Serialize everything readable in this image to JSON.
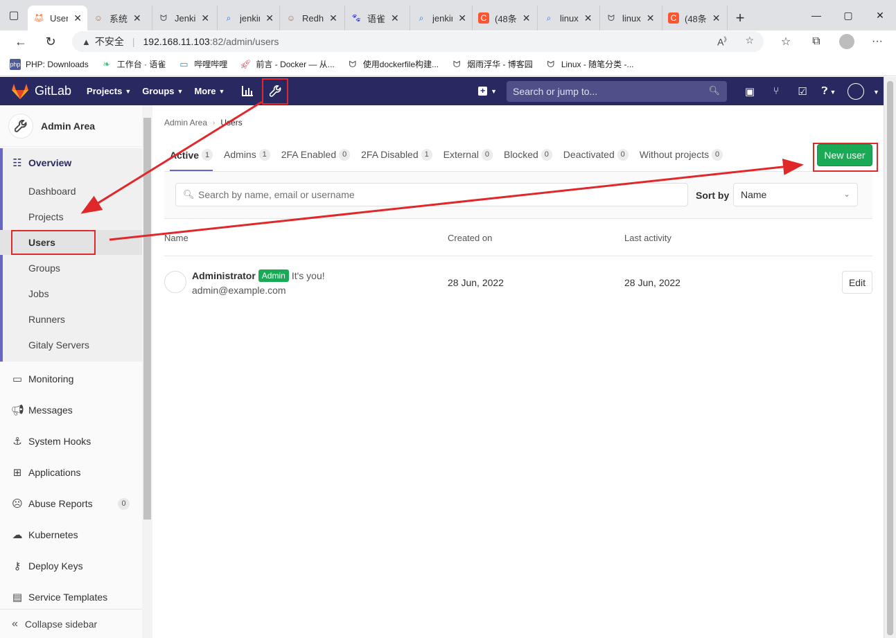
{
  "browser": {
    "tabs": [
      {
        "label": "Users",
        "icon": "gitlab-icon",
        "color": "#fc6d26",
        "active": true
      },
      {
        "label": "系统",
        "icon": "person-icon",
        "color": "#b07050"
      },
      {
        "label": "Jenki",
        "icon": "yuque-icon",
        "color": "#555"
      },
      {
        "label": "jenkir",
        "icon": "search-icon",
        "color": "#1a73e8"
      },
      {
        "label": "Redh",
        "icon": "person-icon",
        "color": "#b07050"
      },
      {
        "label": "语雀",
        "icon": "baidu-icon",
        "color": "#2932e1"
      },
      {
        "label": "jenkir",
        "icon": "search-icon",
        "color": "#1a73e8"
      },
      {
        "label": "(48条",
        "icon": "csdn-icon",
        "color": "#fc5531"
      },
      {
        "label": "linux",
        "icon": "search-icon",
        "color": "#1a73e8"
      },
      {
        "label": "linux",
        "icon": "yuque-icon",
        "color": "#555"
      },
      {
        "label": "(48条",
        "icon": "csdn-icon",
        "color": "#fc5531"
      }
    ],
    "address": {
      "insecure_label": "不安全",
      "host": "192.168.11.103",
      "path": ":82/admin/users"
    },
    "bookmarks": [
      {
        "label": "PHP: Downloads",
        "icon": "php-icon",
        "color": "#4f5b93"
      },
      {
        "label": "工作台 · 语雀",
        "icon": "yuque-leaf-icon",
        "color": "#31cc79"
      },
      {
        "label": "哔哩哔哩",
        "icon": "bilibili-icon",
        "color": "#00a1d6"
      },
      {
        "label": "前言 - Docker — 从...",
        "icon": "rocket-icon",
        "color": "#e84a5f"
      },
      {
        "label": "使用dockerfile构建...",
        "icon": "yuque-icon",
        "color": "#555"
      },
      {
        "label": "烟雨浮华 - 博客园",
        "icon": "yuque-icon",
        "color": "#555"
      },
      {
        "label": "Linux - 随笔分类 -...",
        "icon": "yuque-icon",
        "color": "#555"
      }
    ]
  },
  "gitlab": {
    "brand": "GitLab",
    "menus": [
      "Projects",
      "Groups",
      "More"
    ],
    "search_placeholder": "Search or jump to...",
    "colors": {
      "header": "#292961",
      "accent": "#6666c4",
      "success": "#1aaa55",
      "annotation": "#e0282a"
    }
  },
  "sidebar": {
    "title": "Admin Area",
    "overview_label": "Overview",
    "overview_items": [
      "Dashboard",
      "Projects",
      "Users",
      "Groups",
      "Jobs",
      "Runners",
      "Gitaly Servers"
    ],
    "items": [
      {
        "label": "Monitoring",
        "icon": "monitor-icon"
      },
      {
        "label": "Messages",
        "icon": "megaphone-icon"
      },
      {
        "label": "System Hooks",
        "icon": "anchor-icon"
      },
      {
        "label": "Applications",
        "icon": "grid-icon"
      },
      {
        "label": "Abuse Reports",
        "icon": "frown-icon",
        "badge": "0"
      },
      {
        "label": "Kubernetes",
        "icon": "cloud-icon"
      },
      {
        "label": "Deploy Keys",
        "icon": "key-icon"
      },
      {
        "label": "Service Templates",
        "icon": "template-icon"
      }
    ],
    "collapse_label": "Collapse sidebar"
  },
  "main": {
    "breadcrumb": {
      "parent": "Admin Area",
      "current": "Users"
    },
    "tabs": [
      {
        "label": "Active",
        "count": "1",
        "active": true
      },
      {
        "label": "Admins",
        "count": "1"
      },
      {
        "label": "2FA Enabled",
        "count": "0"
      },
      {
        "label": "2FA Disabled",
        "count": "1"
      },
      {
        "label": "External",
        "count": "0"
      },
      {
        "label": "Blocked",
        "count": "0"
      },
      {
        "label": "Deactivated",
        "count": "0"
      },
      {
        "label": "Without projects",
        "count": "0"
      }
    ],
    "new_user_label": "New user",
    "search_placeholder": "Search by name, email or username",
    "sort_label": "Sort by",
    "sort_value": "Name",
    "columns": [
      "Name",
      "Created on",
      "Last activity"
    ],
    "users": [
      {
        "name": "Administrator",
        "badge": "Admin",
        "note": "It's you!",
        "email": "admin@example.com",
        "created": "28 Jun, 2022",
        "last_activity": "28 Jun, 2022",
        "action": "Edit"
      }
    ]
  }
}
